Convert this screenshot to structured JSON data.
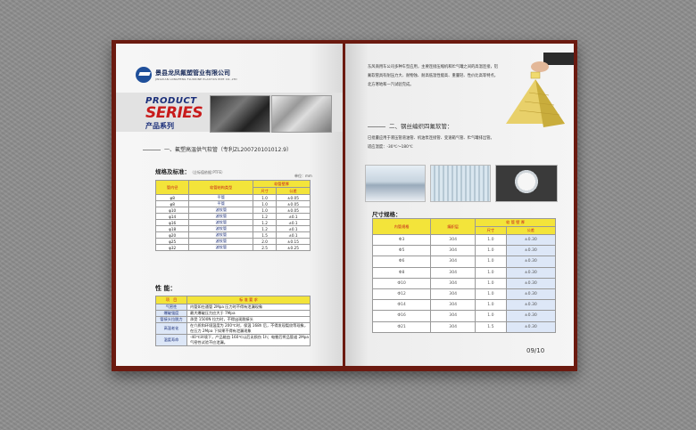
{
  "left": {
    "company_cn": "景县龙凤氟塑管业有限公司",
    "company_en": "JINGXIAN LONGFENG FLUORINE PLASTICS PIPE CO.,LTD",
    "product": "PRODUCT",
    "series": "SERIES",
    "series_cn": "产品系列",
    "section1": "一、氟塑高温供气软管（专利ZL200720101012.9）",
    "spec_label": "规格及标准：",
    "spec_note": "（企标值依据:PTFE）",
    "unit": "单位：mm",
    "spec_table": {
      "headers": [
        "管内径",
        "软管结构类型",
        "软管壁厚"
      ],
      "sub_headers": [
        "尺寸",
        "公差"
      ],
      "rows": [
        [
          "φ8",
          "平管",
          "1.0",
          "±0.05"
        ],
        [
          "φ8",
          "平管",
          "1.0",
          "±0.05"
        ],
        [
          "φ10",
          "波纹管",
          "1.0",
          "±0.05"
        ],
        [
          "φ14",
          "波纹管",
          "1.2",
          "±0.1"
        ],
        [
          "φ16",
          "波纹管",
          "1.2",
          "±0.1"
        ],
        [
          "φ18",
          "波纹管",
          "1.2",
          "±0.1"
        ],
        [
          "φ20",
          "波纹管",
          "1.5",
          "±0.1"
        ],
        [
          "φ25",
          "波纹管",
          "2.0",
          "±0.15"
        ],
        [
          "φ32",
          "波纹管",
          "2.5",
          "±0.25"
        ]
      ]
    },
    "perf_label": "性 能：",
    "perf_table": {
      "headers": [
        "项　目",
        "标 准 要 求"
      ],
      "rows": [
        [
          "气密性",
          "内管如在通管 2Mpa 压力时不得有泄漏现象"
        ],
        [
          "爆破强度",
          "最大爆破压力应大于 7Mpa"
        ],
        [
          "管接头拉脱力",
          "承受 1500N 拉力时，不得出现脱接头"
        ],
        [
          "高温老化",
          "在介质和环境温度为 200℃时，保温 168h 后，不得发现裂纹等现象，在压力 2Mpa 下如果不得有泄漏现象"
        ],
        [
          "温度寿命",
          "-40℃环境下，产品能由 160℃以后无损伤 1h；电晕后将品管道 2Mpa 气密性试验不应泄漏。"
        ]
      ]
    }
  },
  "right": {
    "intro": "东风商用车公司多种车型应用，主要连接压缩机和贮气罐之间的高温连接，铝氟软管具有耐压力大、耐物蚀、耐高低温性能高、重量轻、性价比高等特点，北方寒地和一汽试验完成。",
    "section2": "二、钢丝编织四氟软管：",
    "para2": "已批量应用于液压管道油管、机油泵连接管、变速箱气管、贮气罐排出管。",
    "temp": "适应温度：-30℃～180℃",
    "size_label": "尺寸规格：",
    "size_table": {
      "headers": [
        "内管规格",
        "编织层",
        "软 管 壁 厚"
      ],
      "sub_headers": [
        "尺寸",
        "公差"
      ],
      "rows": [
        [
          "Φ3",
          "304",
          "1.0",
          "±0.30"
        ],
        [
          "Φ5",
          "304",
          "1.0",
          "±0.30"
        ],
        [
          "Φ6",
          "304",
          "1.0",
          "±0.30"
        ],
        [
          "Φ8",
          "304",
          "1.0",
          "±0.30"
        ],
        [
          "Φ10",
          "304",
          "1.0",
          "±0.30"
        ],
        [
          "Φ12",
          "304",
          "1.0",
          "±0.30"
        ],
        [
          "Φ14",
          "304",
          "1.0",
          "±0.30"
        ],
        [
          "Φ16",
          "304",
          "1.0",
          "±0.30"
        ],
        [
          "Φ21",
          "304",
          "1.5",
          "±0.30"
        ]
      ]
    },
    "page_number": "09/10"
  }
}
